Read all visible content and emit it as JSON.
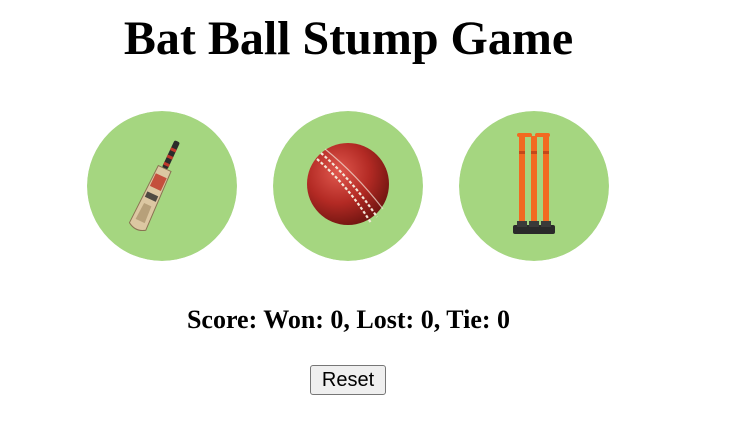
{
  "title": "Bat Ball Stump Game",
  "choices": [
    {
      "name": "bat",
      "icon": "cricket-bat-icon"
    },
    {
      "name": "ball",
      "icon": "cricket-ball-icon"
    },
    {
      "name": "stump",
      "icon": "cricket-stumps-icon"
    }
  ],
  "score": {
    "text": "Score: Won: 0, Lost: 0, Tie: 0",
    "won": 0,
    "lost": 0,
    "tie": 0
  },
  "reset_label": "Reset",
  "colors": {
    "choice_background": "#a5d680",
    "page_background": "#ffffff",
    "ball_red": "#b32a24",
    "stump_orange": "#f26a21"
  }
}
